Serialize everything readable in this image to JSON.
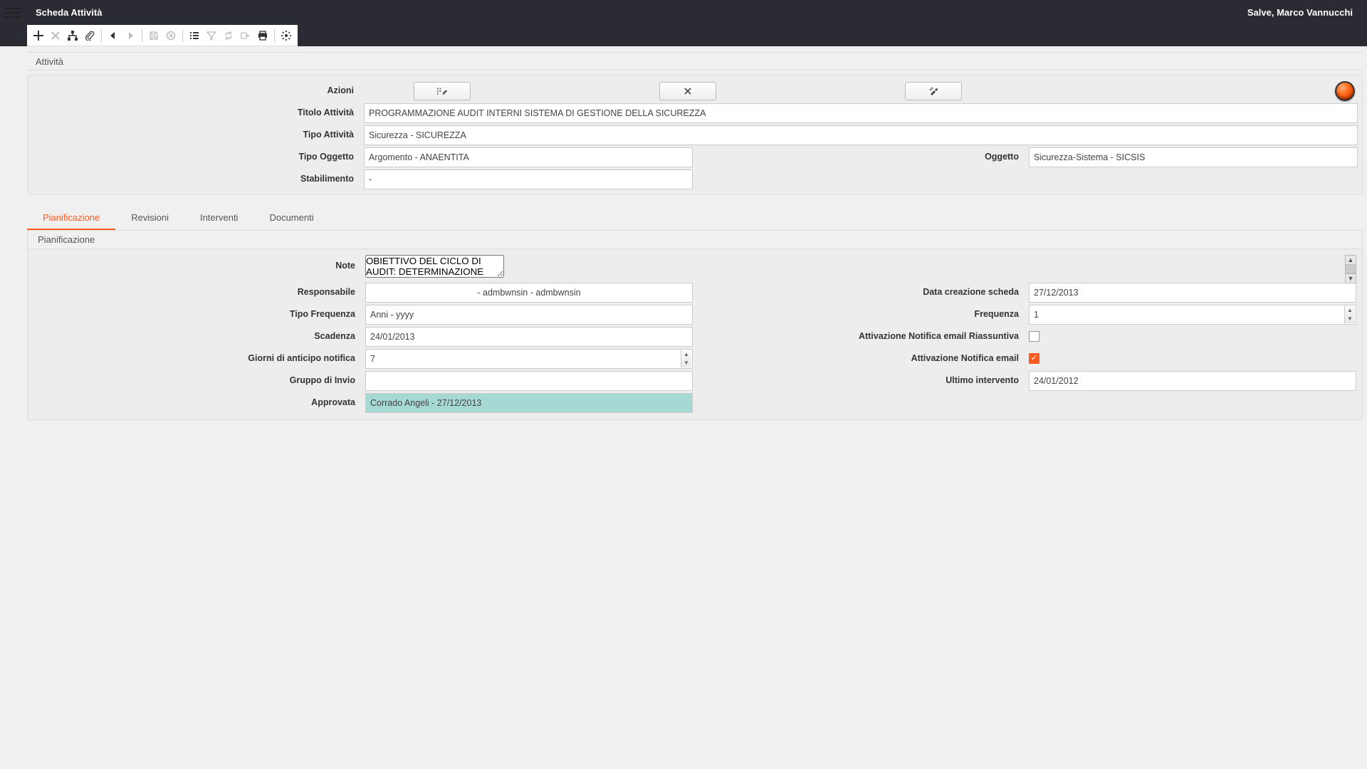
{
  "header": {
    "title": "Scheda Attività",
    "user_greeting": "Salve, Marco Vannucchi"
  },
  "toolbar_icons": [
    "plus",
    "close",
    "hierarchy",
    "attach",
    "back",
    "forward",
    "save",
    "cancel-circle",
    "list",
    "filter",
    "refresh-a",
    "refresh-b",
    "print",
    "settings"
  ],
  "section": {
    "title": "Attività"
  },
  "form": {
    "azioni_label": "Azioni",
    "titolo_label": "Titolo Attività",
    "titolo_value": "PROGRAMMAZIONE AUDIT INTERNI SISTEMA DI GESTIONE DELLA SICUREZZA",
    "tipo_attivita_label": "Tipo Attività",
    "tipo_attivita_value": "Sicurezza - SICUREZZA",
    "tipo_oggetto_label": "Tipo Oggetto",
    "tipo_oggetto_value": "Argomento - ANAENTITA",
    "oggetto_label": "Oggetto",
    "oggetto_value": "Sicurezza-Sistema - SICSIS",
    "stabilimento_label": "Stabilimento",
    "stabilimento_value": "-"
  },
  "tabs": [
    {
      "id": "pianificazione",
      "label": "Pianificazione",
      "active": true
    },
    {
      "id": "revisioni",
      "label": "Revisioni",
      "active": false
    },
    {
      "id": "interventi",
      "label": "Interventi",
      "active": false
    },
    {
      "id": "documenti",
      "label": "Documenti",
      "active": false
    }
  ],
  "plan": {
    "section_title": "Pianificazione",
    "note_label": "Note",
    "note_value": "OBIETTIVO DEL CICLO DI AUDIT: DETERMINAZIONE DELLA CONFORMITA' DEL SISTEMA DI GESTIONE OHSAS 18001 A QUANTO PIANIFICATO E AI REQUISITI DELLA NORMA OHSAS 18001, DELLA CORRETTA ATTUAZIONE DEL SISTEMA, DELL'EFFICACIA DEL SISTEMA IN RELAZIONE ALLA POLITICA E AGLI OBIETTIVI.",
    "responsabile_label": "Responsabile",
    "responsabile_value": "- admbwnsin - admbwnsin",
    "data_creazione_label": "Data creazione scheda",
    "data_creazione_value": "27/12/2013",
    "tipo_frequenza_label": "Tipo Frequenza",
    "tipo_frequenza_value": "Anni - yyyy",
    "frequenza_label": "Frequenza",
    "frequenza_value": "1",
    "scadenza_label": "Scadenza",
    "scadenza_value": "24/01/2013",
    "notifica_riassuntiva_label": "Attivazione Notifica email Riassuntiva",
    "notifica_riassuntiva_checked": false,
    "giorni_anticipo_label": "Giorni di anticipo notifica",
    "giorni_anticipo_value": "7",
    "notifica_email_label": "Attivazione Notifica email",
    "notifica_email_checked": true,
    "gruppo_invio_label": "Gruppo di Invio",
    "gruppo_invio_value": "",
    "ultimo_intervento_label": "Ultimo intervento",
    "ultimo_intervento_value": "24/01/2012",
    "approvata_label": "Approvata",
    "approvata_value": "Corrado Angeli - 27/12/2013"
  },
  "status_color": "#ff6a1a"
}
